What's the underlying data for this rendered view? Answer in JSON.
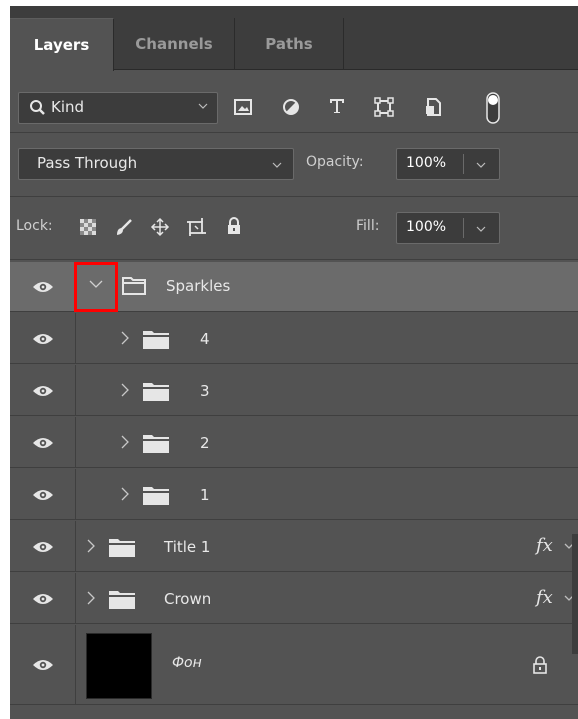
{
  "tabs": [
    {
      "label": "Layers"
    },
    {
      "label": "Channels"
    },
    {
      "label": "Paths"
    }
  ],
  "filter": {
    "kind_label": "Kind",
    "icons": [
      "image-filter-icon",
      "adjustment-filter-icon",
      "type-filter-icon",
      "shape-filter-icon",
      "smart-object-filter-icon",
      "filter-toggle-icon"
    ]
  },
  "blend": {
    "mode": "Pass Through",
    "opacity_label": "Opacity:",
    "opacity_value": "100%"
  },
  "lock": {
    "label": "Lock:",
    "fill_label": "Fill:",
    "fill_value": "100%"
  },
  "layers": [
    {
      "name": "Sparkles",
      "kind": "group",
      "expanded": true,
      "selected": true
    },
    {
      "name": "4",
      "kind": "group",
      "expanded": false,
      "nested": true
    },
    {
      "name": "3",
      "kind": "group",
      "expanded": false,
      "nested": true
    },
    {
      "name": "2",
      "kind": "group",
      "expanded": false,
      "nested": true
    },
    {
      "name": "1",
      "kind": "group",
      "expanded": false,
      "nested": true
    },
    {
      "name": "Title 1",
      "kind": "group",
      "expanded": false,
      "fx": "fx"
    },
    {
      "name": "Crown",
      "kind": "group",
      "expanded": false,
      "fx": "fx"
    },
    {
      "name": "Фон",
      "kind": "background",
      "locked": true
    }
  ],
  "highlight_color": "#ff0000"
}
